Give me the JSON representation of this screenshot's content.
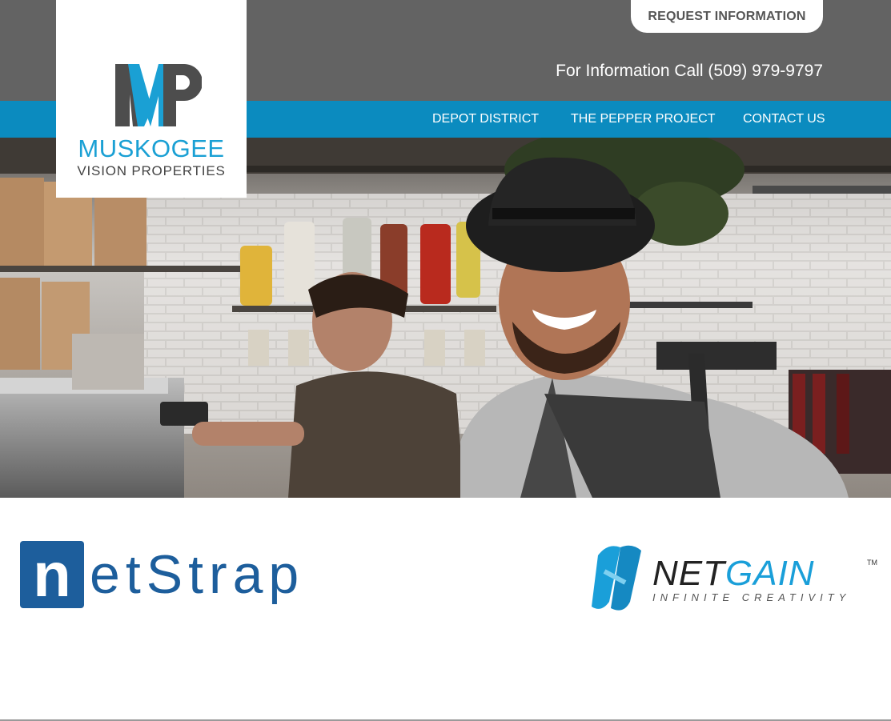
{
  "header": {
    "request_button": "REQUEST INFORMATION",
    "phone_text": "For Information Call (509) 979-9797"
  },
  "logo": {
    "monogram": "MP",
    "line1": "MUSKOGEE",
    "line2": "VISION PROPERTIES"
  },
  "nav": {
    "items": [
      {
        "label": "DEPOT DISTRICT"
      },
      {
        "label": "THE PEPPER PROJECT"
      },
      {
        "label": "CONTACT US"
      }
    ]
  },
  "partners": {
    "netstrap": {
      "initial": "n",
      "rest": "etStrap"
    },
    "netgain": {
      "net": "NET",
      "gain": "GAIN",
      "tagline": "INFINITE CREATIVITY",
      "tm": "TM"
    }
  },
  "colors": {
    "topbar": "#636363",
    "navbar": "#0b8bbf",
    "brand_blue": "#1aa0d4",
    "netstrap_blue": "#1d5e9c"
  }
}
